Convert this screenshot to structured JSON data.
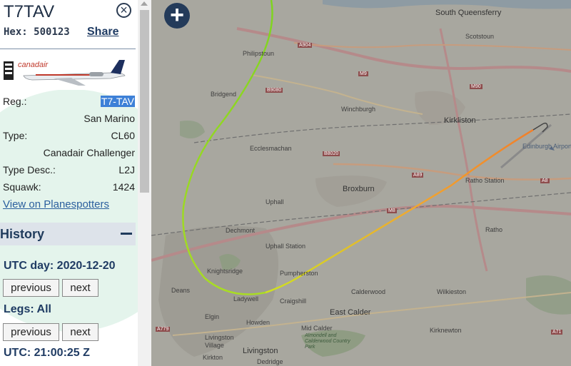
{
  "aircraft": {
    "callsign": "T7TAV",
    "hex_label": "Hex:",
    "hex": "500123",
    "share_label": "Share",
    "photo_logo": "canadair",
    "reg_label": "Reg.:",
    "reg": "T7-TAV",
    "country": "San Marino",
    "type_label": "Type:",
    "type": "CL60",
    "type_name": "Canadair Challenger",
    "type_desc_label": "Type Desc.:",
    "type_desc": "L2J",
    "squawk_label": "Squawk:",
    "squawk": "1424",
    "planespotters_link": "View on Planespotters"
  },
  "history": {
    "title": "History",
    "utc_day": "UTC day: 2020-12-20",
    "previous_label": "previous",
    "next_label": "next",
    "legs": "Legs: All",
    "utc_time": "UTC: 21:00:25 Z"
  },
  "map": {
    "zoom_in_label": "+",
    "places": {
      "south_queensferry": "South Queensferry",
      "scotstoun": "Scotstoun",
      "philipstoun": "Philipstoun",
      "bridgend": "Bridgend",
      "winchburgh": "Winchburgh",
      "kirkliston": "Kirkliston",
      "edinburgh_airport": "Edinburgh Airport",
      "ecclesmachan": "Ecclesmachan",
      "broxburn": "Broxburn",
      "ratho_station": "Ratho Station",
      "uphall": "Uphall",
      "dechmont": "Dechmont",
      "uphall_station": "Uphall Station",
      "ratho": "Ratho",
      "knightsridge": "Knightsridge",
      "pumpherston": "Pumpherston",
      "deans": "Deans",
      "ladywell": "Ladywell",
      "craigshill": "Craigshill",
      "calderwood": "Calderwood",
      "wilkieston": "Wilkieston",
      "east_calder": "East Calder",
      "elgin": "Elgin",
      "howden": "Howden",
      "mid_calder": "Mid Calder",
      "almondell": "Almondell and Calderwood Country Park",
      "kirknewton": "Kirknewton",
      "livingston_village": "Livingston Village",
      "livingston": "Livingston",
      "kirkton": "Kirkton",
      "dedridge": "Dedridge"
    },
    "roads": [
      "A904",
      "M9",
      "B9080",
      "M90",
      "B8020",
      "A89",
      "M8",
      "A8",
      "A71",
      "A779"
    ],
    "track_colors": [
      "#7ed321",
      "#cde21f",
      "#f0a830",
      "#f07f2b"
    ]
  }
}
